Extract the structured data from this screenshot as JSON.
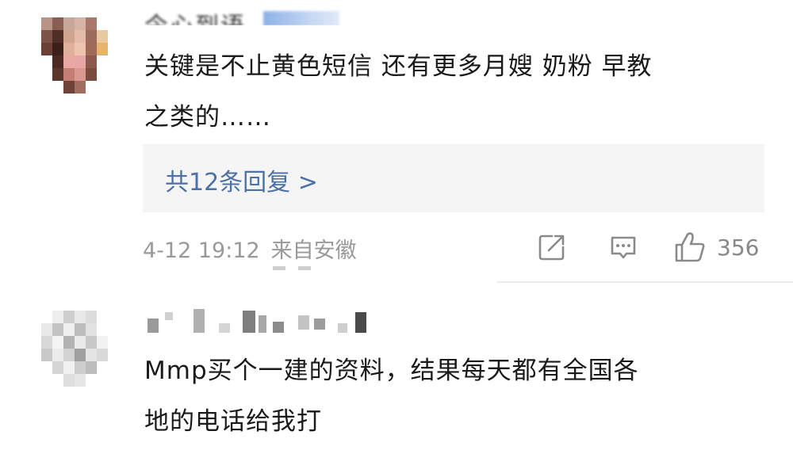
{
  "comments": [
    {
      "username": "今心到语",
      "text_line1": "关键是不止黄色短信 还有更多月嫂 奶粉 早教",
      "text_line2": "之类的……",
      "replies_label": "共12条回复 >",
      "date": "4-12 19:12",
      "source": "来自安徽",
      "likes": "356",
      "icons": {
        "share": "share-icon",
        "comment": "comment-icon",
        "like": "thumbs-up-icon"
      }
    },
    {
      "text_line1": "Mmp买个一建的资料，结果每天都有全国各",
      "text_line2": "地的电话给我打"
    }
  ],
  "colors": {
    "reply_link": "#4c70a8",
    "meta_text": "#999999",
    "reply_box_bg": "#f5f5f5",
    "text": "#1a1a1a"
  }
}
